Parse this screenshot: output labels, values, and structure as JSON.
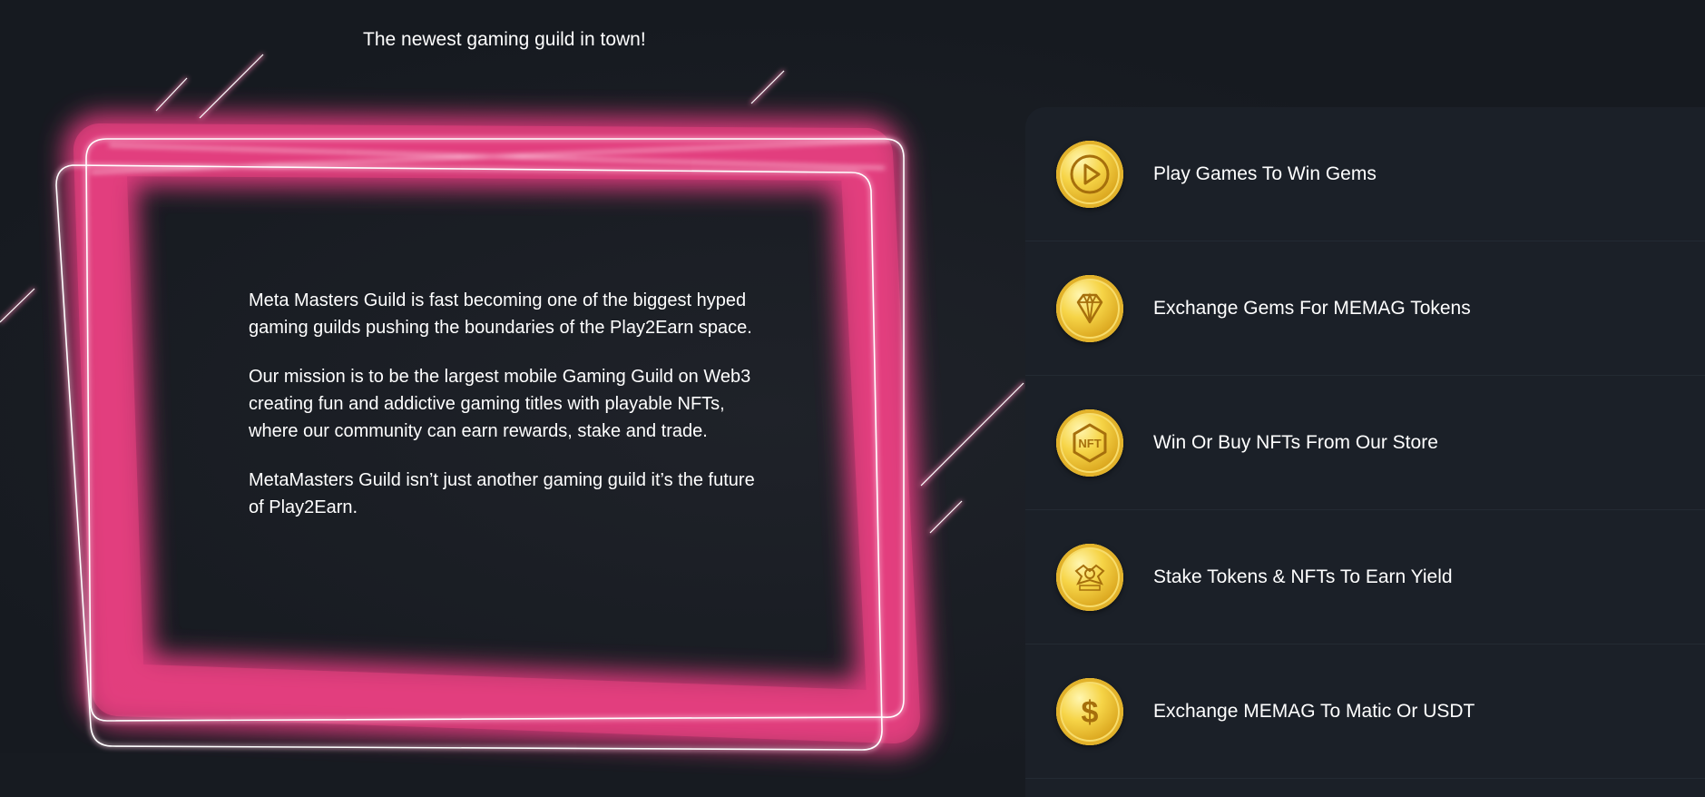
{
  "hero": {
    "tagline": "The newest gaming guild in town!"
  },
  "intro": {
    "paragraphs": [
      "Meta Masters Guild is fast becoming one of the biggest hyped gaming guilds pushing the boundaries of the Play2Earn space.",
      "Our mission is to be the largest mobile Gaming Guild on Web3 creating fun and addictive gaming titles with playable NFTs, where our community can earn rewards, stake and trade.",
      "MetaMasters Guild isn’t just another gaming guild it’s the future of Play2Earn."
    ]
  },
  "features": {
    "items": [
      {
        "label": "Play Games To Win Gems",
        "icon": "play-icon"
      },
      {
        "label": "Exchange Gems For MEMAG Tokens",
        "icon": "diamond-icon"
      },
      {
        "label": "Win Or Buy NFTs From Our Store",
        "icon": "nft-icon",
        "icon_text": "NFT"
      },
      {
        "label": "Stake Tokens & NFTs To Earn Yield",
        "icon": "guild-crest-icon"
      },
      {
        "label": "Exchange MEMAG To Matic Or USDT",
        "icon": "dollar-icon",
        "icon_text": "$"
      }
    ]
  },
  "colors": {
    "background": "#171b21",
    "panel": "#1b2028",
    "neon": "#ff4f97",
    "gold": "#f3c93c"
  }
}
